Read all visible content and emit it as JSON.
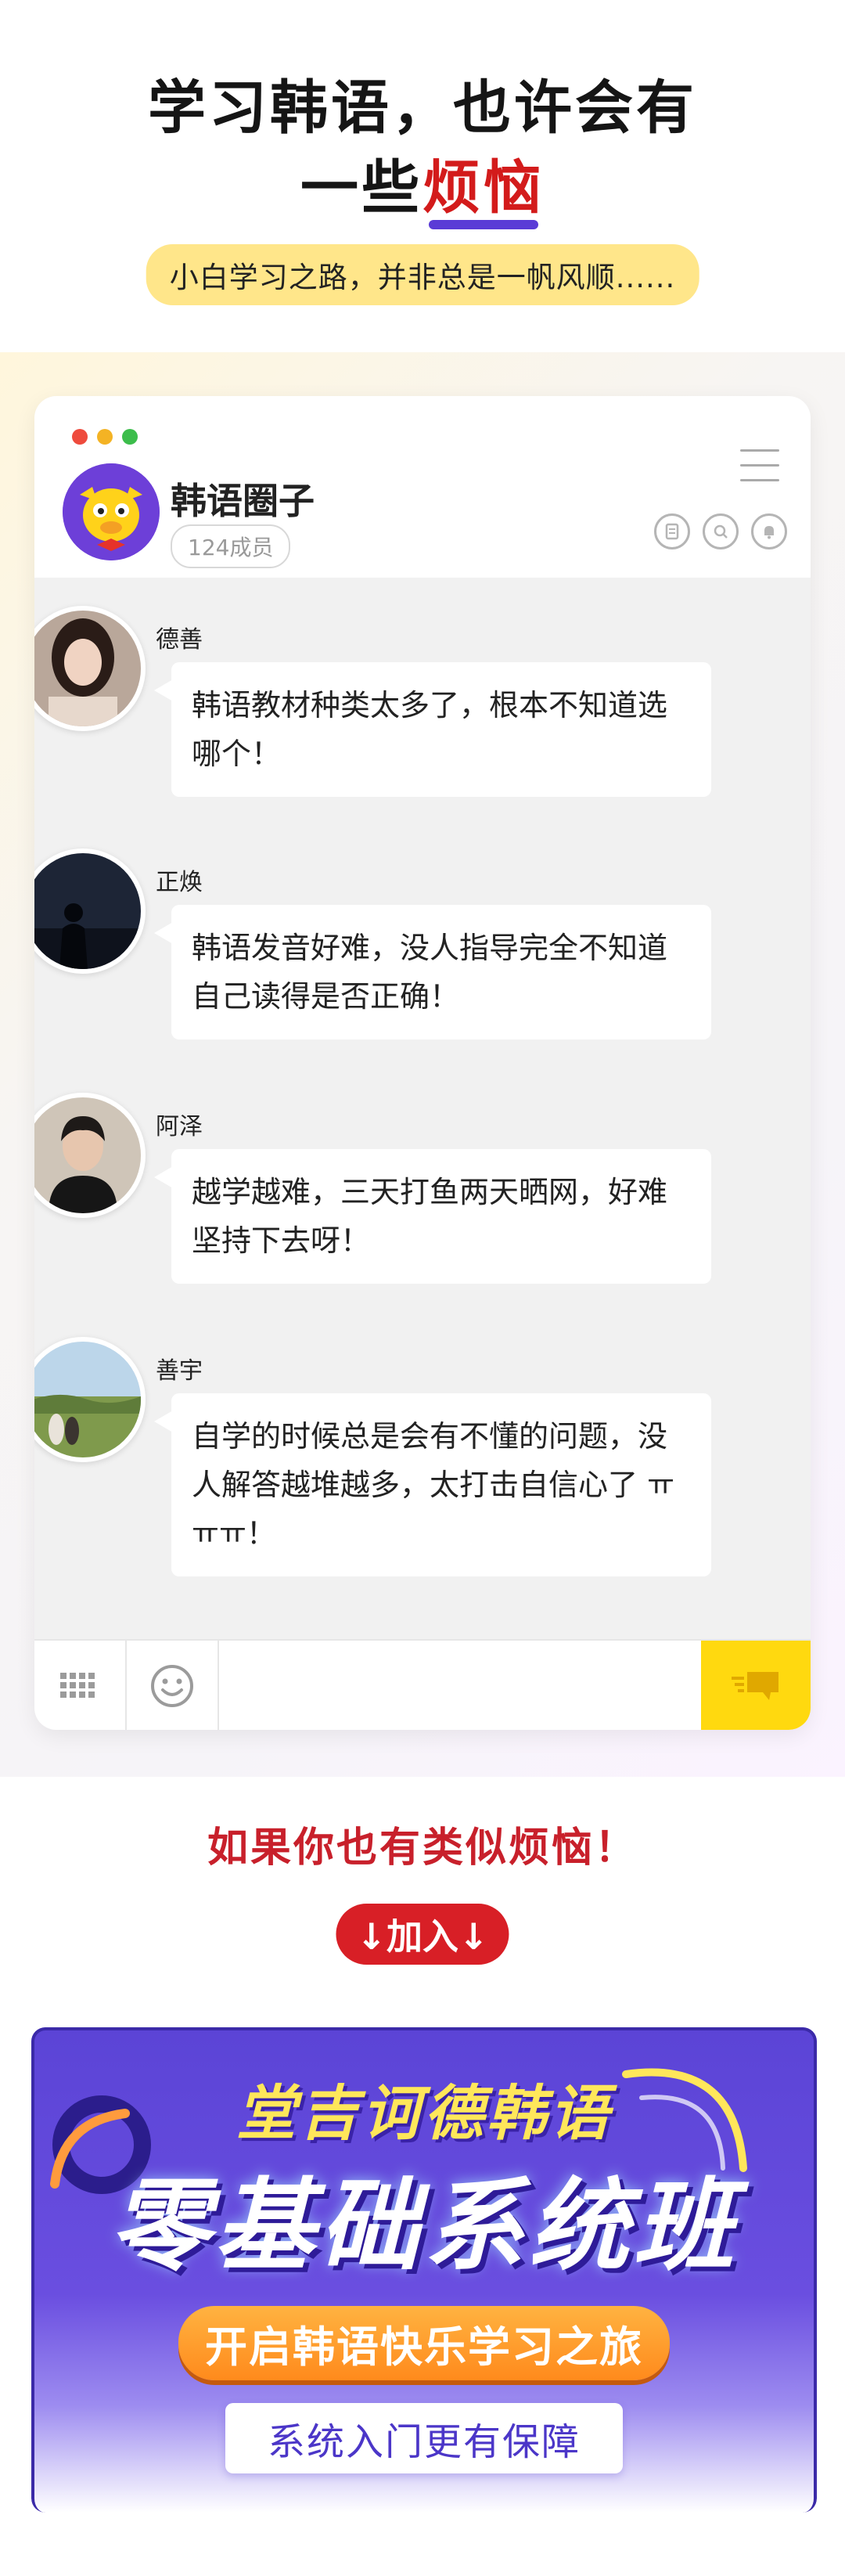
{
  "header": {
    "title_line1": "学习韩语，也许会有",
    "title_line2_prefix": "一些",
    "title_line2_highlight": "烦恼",
    "subtitle": "小白学习之路，并非总是一帆风顺......"
  },
  "chat": {
    "group_name": "韩语圈子",
    "member_count": "124成员",
    "messages": [
      {
        "user": "德善",
        "text": "韩语教材种类太多了，根本不知道选哪个！"
      },
      {
        "user": "正焕",
        "text": "韩语发音好难，没人指导完全不知道自己读得是否正确！"
      },
      {
        "user": "阿泽",
        "text": "越学越难，三天打鱼两天晒网，好难坚持下去呀！"
      },
      {
        "user": "善宇",
        "text": "自学的时候总是会有不懂的问题，没人解答越堆越多，太打击自信心了 ㅠㅠㅠ！"
      }
    ]
  },
  "cta": {
    "text": "如果你也有类似烦恼！",
    "join_label": "↓加入↓"
  },
  "banner": {
    "title1": "堂吉诃德韩语",
    "title2": "零基础系统班",
    "pill1": "开启韩语快乐学习之旅",
    "pill2": "系统入门更有保障"
  },
  "colors": {
    "accent_red": "#d31b1b",
    "underline_purple": "#5a3cd6",
    "pill_yellow": "#ffe68a",
    "send_yellow": "#ffd90f",
    "banner_purple": "#5b44d6"
  },
  "icons": [
    "menu-icon",
    "note-icon",
    "search-icon",
    "bell-icon",
    "keyboard-icon",
    "emoji-icon",
    "send-icon"
  ]
}
